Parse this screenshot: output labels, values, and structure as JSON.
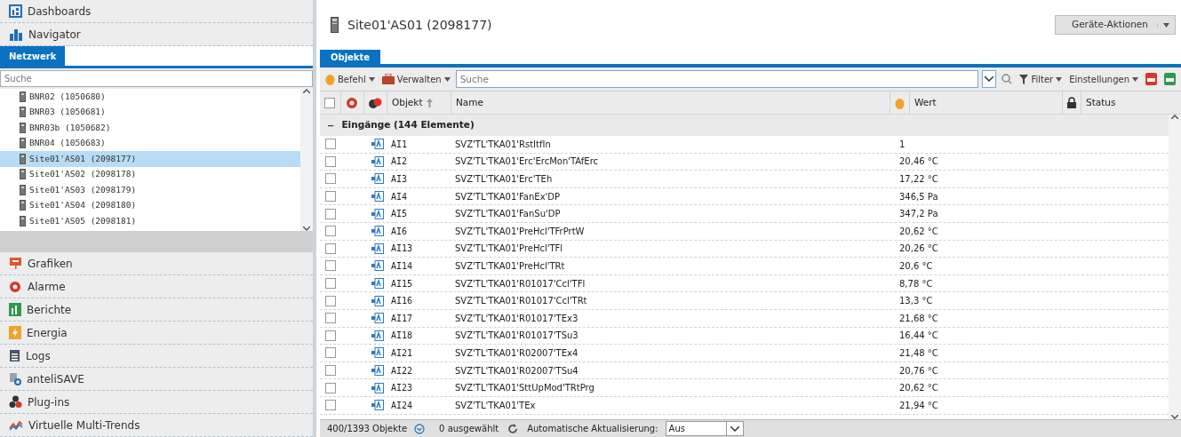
{
  "sidebar": {
    "top_items": [
      {
        "kind": "dashboards",
        "label": "Dashboards"
      },
      {
        "kind": "navigator",
        "label": "Navigator"
      }
    ],
    "tabs": [
      {
        "label": "Netzwerk",
        "selected": true
      }
    ],
    "search": {
      "placeholder": "Suche"
    },
    "tree": [
      {
        "label": "BNR02 (1050680)",
        "selected": false
      },
      {
        "label": "BNR03 (1050681)",
        "selected": false
      },
      {
        "label": "BNR03b (1050682)",
        "selected": false
      },
      {
        "label": "BNR04 (1050683)",
        "selected": false
      },
      {
        "label": "Site01'AS01 (2098177)",
        "selected": true
      },
      {
        "label": "Site01'AS02 (2098178)",
        "selected": false
      },
      {
        "label": "Site01'AS03 (2098179)",
        "selected": false
      },
      {
        "label": "Site01'AS04 (2098180)",
        "selected": false
      },
      {
        "label": "Site01'AS05 (2098181)",
        "selected": false
      }
    ],
    "bottom_items": [
      {
        "kind": "grafiken",
        "label": "Grafiken"
      },
      {
        "kind": "alarme",
        "label": "Alarme"
      },
      {
        "kind": "berichte",
        "label": "Berichte"
      },
      {
        "kind": "energia",
        "label": "Energia"
      },
      {
        "kind": "logs",
        "label": "Logs"
      },
      {
        "kind": "antelisave",
        "label": "anteliSAVE"
      },
      {
        "kind": "plugins",
        "label": "Plug-ins"
      },
      {
        "kind": "trends",
        "label": "Virtuelle Multi-Trends"
      }
    ]
  },
  "header": {
    "title": "Site01'AS01 (2098177)",
    "action_button": "Geräte-Aktionen"
  },
  "tabs": [
    {
      "label": "Objekte",
      "selected": true
    }
  ],
  "toolbar": {
    "befehl": "Befehl",
    "verwalten": "Verwalten",
    "search_placeholder": "Suche",
    "filter": "Filter",
    "settings": "Einstellungen"
  },
  "table": {
    "columns": {
      "objekt": "Objekt",
      "name": "Name",
      "wert": "Wert",
      "status": "Status"
    },
    "select_all_checked": false,
    "group": {
      "toggle": "−",
      "label": "Eingänge (144 Elemente)",
      "expanded": true
    },
    "rows": [
      {
        "checked": false,
        "objekt": "AI1",
        "name": "SVZ'TL'TKA01'RstItfIn",
        "wert": "1"
      },
      {
        "checked": false,
        "objekt": "AI2",
        "name": "SVZ'TL'TKA01'Erc'ErcMon'TAfErc",
        "wert": "20,46 °C"
      },
      {
        "checked": false,
        "objekt": "AI3",
        "name": "SVZ'TL'TKA01'Erc'TEh",
        "wert": "17,22 °C"
      },
      {
        "checked": false,
        "objekt": "AI4",
        "name": "SVZ'TL'TKA01'FanEx'DP",
        "wert": "346,5 Pa"
      },
      {
        "checked": false,
        "objekt": "AI5",
        "name": "SVZ'TL'TKA01'FanSu'DP",
        "wert": "347,2 Pa"
      },
      {
        "checked": false,
        "objekt": "AI6",
        "name": "SVZ'TL'TKA01'PreHcl'TFrPrtW",
        "wert": "20,62 °C"
      },
      {
        "checked": false,
        "objekt": "AI13",
        "name": "SVZ'TL'TKA01'PreHcl'TFl",
        "wert": "20,26 °C"
      },
      {
        "checked": false,
        "objekt": "AI14",
        "name": "SVZ'TL'TKA01'PreHcl'TRt",
        "wert": "20,6 °C"
      },
      {
        "checked": false,
        "objekt": "AI15",
        "name": "SVZ'TL'TKA01'R01017'Ccl'TFl",
        "wert": "8,78 °C"
      },
      {
        "checked": false,
        "objekt": "AI16",
        "name": "SVZ'TL'TKA01'R01017'Ccl'TRt",
        "wert": "13,3 °C"
      },
      {
        "checked": false,
        "objekt": "AI17",
        "name": "SVZ'TL'TKA01'R01017'TEx3",
        "wert": "21,68 °C"
      },
      {
        "checked": false,
        "objekt": "AI18",
        "name": "SVZ'TL'TKA01'R01017'TSu3",
        "wert": "16,44 °C"
      },
      {
        "checked": false,
        "objekt": "AI21",
        "name": "SVZ'TL'TKA01'R02007'TEx4",
        "wert": "21,48 °C"
      },
      {
        "checked": false,
        "objekt": "AI22",
        "name": "SVZ'TL'TKA01'R02007'TSu4",
        "wert": "20,76 °C"
      },
      {
        "checked": false,
        "objekt": "AI23",
        "name": "SVZ'TL'TKA01'SttUpMod'TRtPrg",
        "wert": "20,62 °C"
      },
      {
        "checked": false,
        "objekt": "AI24",
        "name": "SVZ'TL'TKA01'TEx",
        "wert": "21,94 °C"
      }
    ]
  },
  "status_bar": {
    "count": "400/1393 Objekte",
    "selected": "0 ausgewählt",
    "auto_label": "Automatische Aktualisierung:",
    "auto_value": "Aus"
  }
}
